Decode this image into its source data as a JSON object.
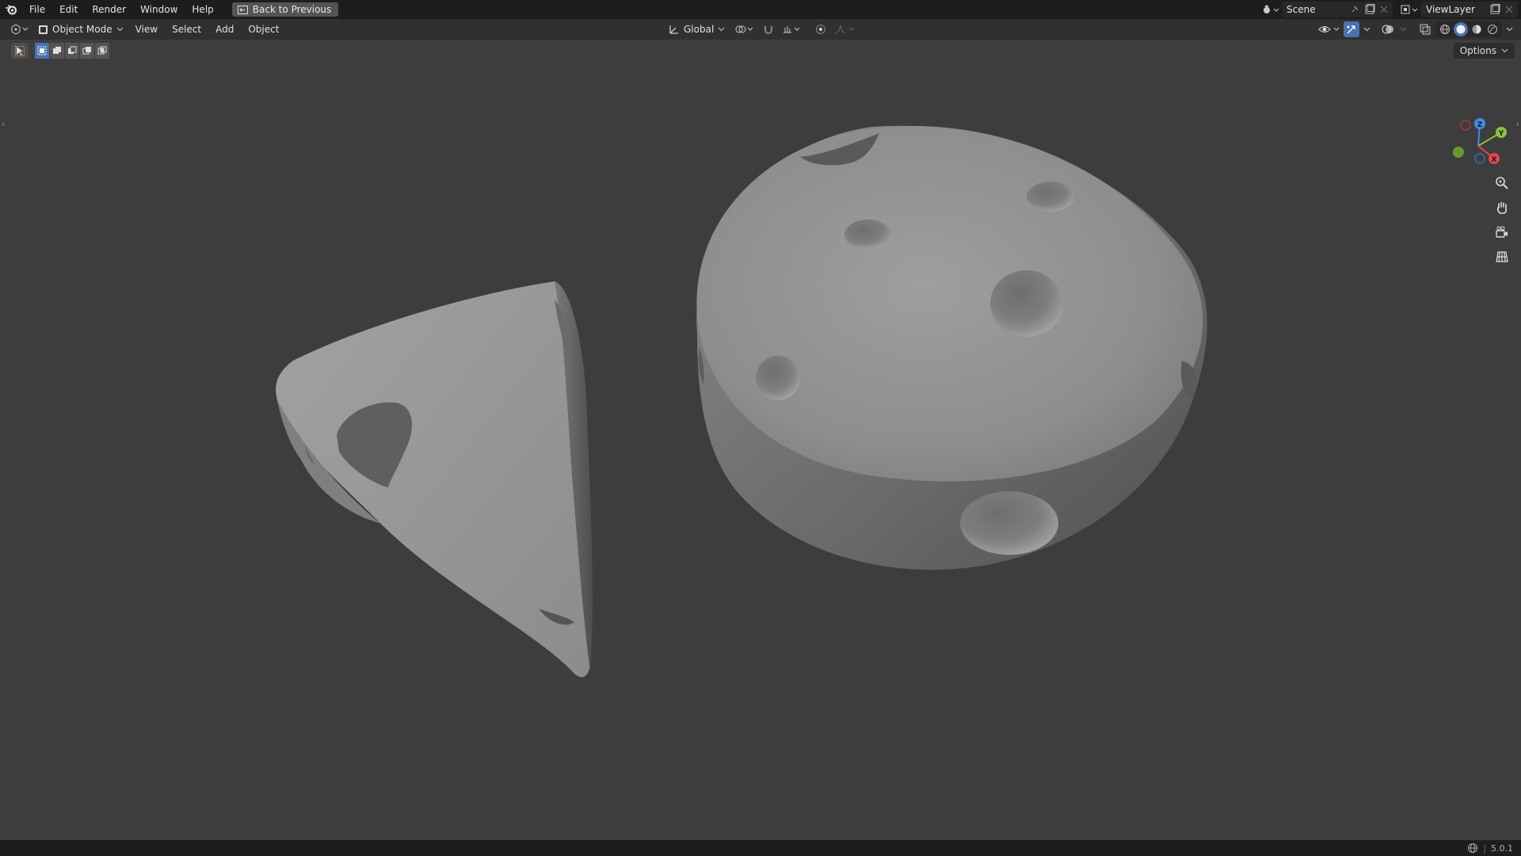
{
  "topbar": {
    "menus": [
      "File",
      "Edit",
      "Render",
      "Window",
      "Help"
    ],
    "back_button": "Back to Previous",
    "scene_label": "Scene",
    "viewlayer_label": "ViewLayer"
  },
  "header": {
    "mode": "Object Mode",
    "menus": [
      "View",
      "Select",
      "Add",
      "Object"
    ],
    "transform_orientation": "Global"
  },
  "toolbar": {
    "options_label": "Options"
  },
  "gizmo": {
    "z": "Z",
    "y": "Y",
    "x": "X"
  },
  "status": {
    "version": "5.0.1"
  },
  "colors": {
    "accent": "#4772b3",
    "axis_x": "#e8454f",
    "axis_y": "#8bc33a",
    "axis_z": "#3d8ee6",
    "background": "#3d3d3d"
  }
}
